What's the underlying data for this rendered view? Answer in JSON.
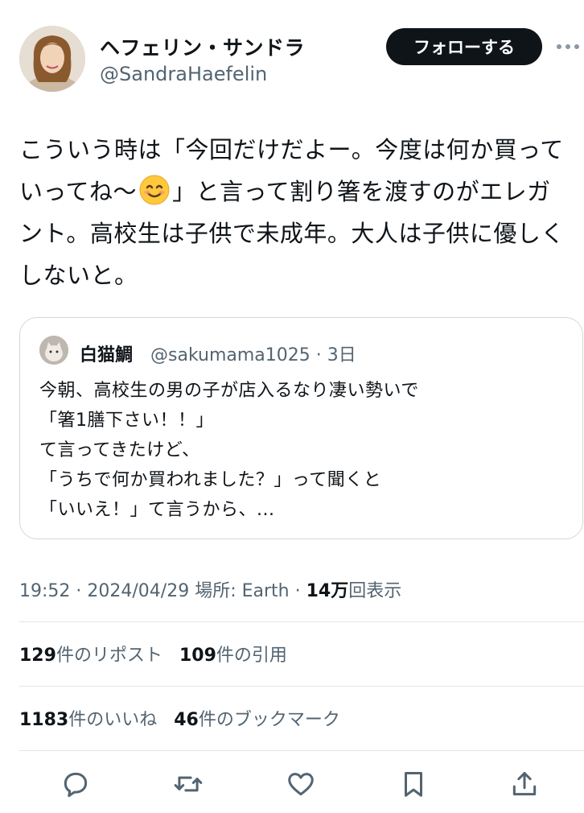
{
  "author": {
    "name": "ヘフェリン・サンドラ",
    "handle": "@SandraHaefelin"
  },
  "follow_label": "フォローする",
  "more_icon": "more-horizontal-icon",
  "post": {
    "line1": "こういう時は「今回だけだよー。今度は何か買って",
    "line2a": "いってね〜",
    "line2b": "」と言って割り箸を渡すのがエレガ",
    "line3": "ント。高校生は子供で未成年。大人は子供に優しく",
    "line4": "しないと。",
    "emoji": "smiling-face-emoji"
  },
  "quote": {
    "name": "白猫鯛",
    "handle": "@sakumama1025 · 3日",
    "lines": [
      "今朝、高校生の男の子が店入るなり凄い勢いで",
      "「箸1膳下さい！！」",
      "て言ってきたけど、",
      "「うちで何か買われました？」って聞くと",
      "「いいえ！」て言うから、..."
    ]
  },
  "meta": {
    "time": "19:52",
    "date": "2024/04/29",
    "place": "場所: Earth",
    "views_count": "14万",
    "views_label": "回表示"
  },
  "stats": {
    "reposts_count": "129",
    "reposts_label": "件のリポスト",
    "quotes_count": "109",
    "quotes_label": "件の引用",
    "likes_count": "1183",
    "likes_label": "件のいいね",
    "bookmarks_count": "46",
    "bookmarks_label": "件のブックマーク"
  },
  "actions": [
    "reply-icon",
    "repost-icon",
    "like-icon",
    "bookmark-icon",
    "share-icon"
  ],
  "colors": {
    "text_primary": "#0f1419",
    "text_secondary": "#536471",
    "border": "#cfd9de",
    "button_bg": "#0f1419"
  }
}
